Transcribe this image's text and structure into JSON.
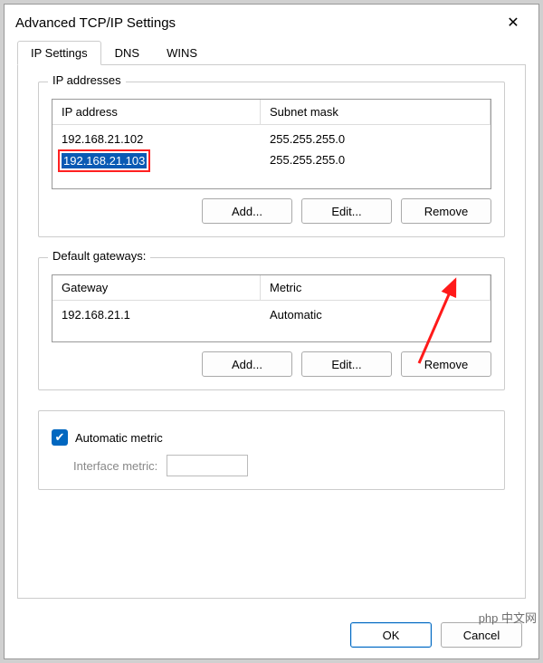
{
  "title": "Advanced TCP/IP Settings",
  "tabs": [
    "IP Settings",
    "DNS",
    "WINS"
  ],
  "ip_group": {
    "legend": "IP addresses",
    "headers": [
      "IP address",
      "Subnet mask"
    ],
    "rows": [
      {
        "ip": "192.168.21.102",
        "mask": "255.255.255.0",
        "selected": false
      },
      {
        "ip": "192.168.21.103",
        "mask": "255.255.255.0",
        "selected": true
      }
    ],
    "buttons": {
      "add": "Add...",
      "edit": "Edit...",
      "remove": "Remove"
    }
  },
  "gw_group": {
    "legend": "Default gateways:",
    "headers": [
      "Gateway",
      "Metric"
    ],
    "rows": [
      {
        "gw": "192.168.21.1",
        "metric": "Automatic"
      }
    ],
    "buttons": {
      "add": "Add...",
      "edit": "Edit...",
      "remove": "Remove"
    }
  },
  "metric": {
    "auto_label": "Automatic metric",
    "auto_checked": true,
    "if_label": "Interface metric:",
    "if_value": ""
  },
  "footer": {
    "ok": "OK",
    "cancel": "Cancel"
  },
  "watermark": "php 中文网"
}
